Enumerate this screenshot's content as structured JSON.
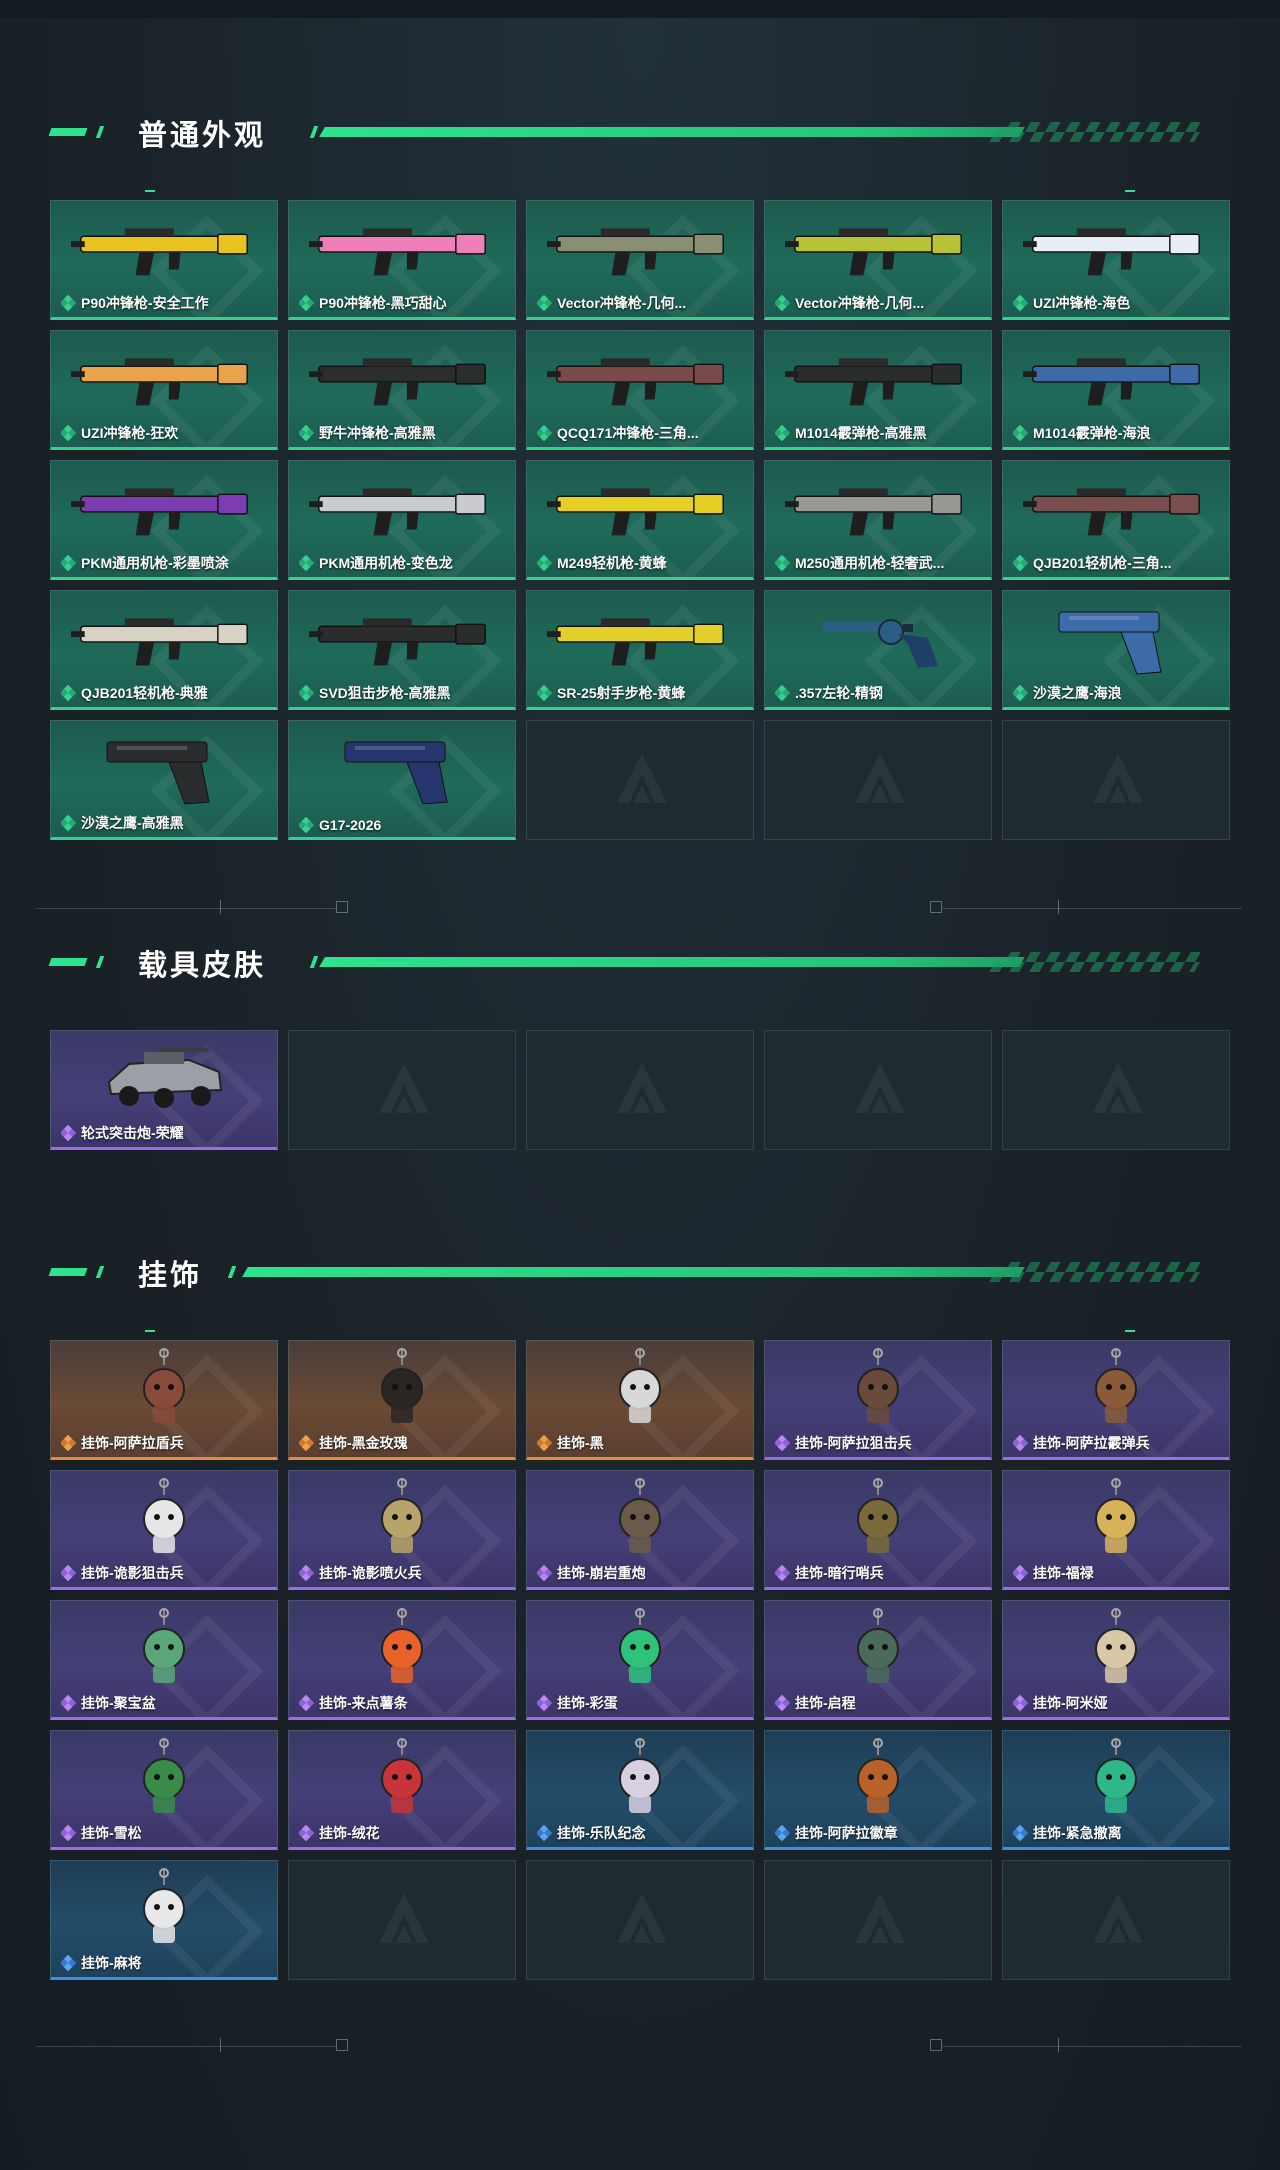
{
  "sections": [
    {
      "title": "普通外观",
      "items": [
        {
          "label": "P90冲锋枪-安全工作",
          "rarity": "green",
          "art": "gun-icon",
          "color": "#e8c321"
        },
        {
          "label": "P90冲锋枪-黑巧甜心",
          "rarity": "green",
          "art": "gun-icon",
          "color": "#ef7fb8"
        },
        {
          "label": "Vector冲锋枪-几何...",
          "rarity": "green",
          "art": "gun-icon",
          "color": "#8a8f74"
        },
        {
          "label": "Vector冲锋枪-几何...",
          "rarity": "green",
          "art": "gun-icon",
          "color": "#b8c238"
        },
        {
          "label": "UZI冲锋枪-海色",
          "rarity": "green",
          "art": "gun-icon",
          "color": "#e9eef6"
        },
        {
          "label": "UZI冲锋枪-狂欢",
          "rarity": "green",
          "art": "gun-icon",
          "color": "#e9a34a"
        },
        {
          "label": "野牛冲锋枪-高雅黑",
          "rarity": "green",
          "art": "gun-icon",
          "color": "#2b2d2f"
        },
        {
          "label": "QCQ171冲锋枪-三角...",
          "rarity": "green",
          "art": "gun-icon",
          "color": "#7a4a4a"
        },
        {
          "label": "M1014霰弹枪-高雅黑",
          "rarity": "green",
          "art": "gun-icon",
          "color": "#2a2c2e"
        },
        {
          "label": "M1014霰弹枪-海浪",
          "rarity": "green",
          "art": "gun-icon",
          "color": "#3d6aa8"
        },
        {
          "label": "PKM通用机枪-彩墨喷涂",
          "rarity": "green",
          "art": "gun-icon",
          "color": "#7b3db0"
        },
        {
          "label": "PKM通用机枪-变色龙",
          "rarity": "green",
          "art": "gun-icon",
          "color": "#c9cbd0"
        },
        {
          "label": "M249轻机枪-黄蜂",
          "rarity": "green",
          "art": "gun-icon",
          "color": "#e6cf23"
        },
        {
          "label": "M250通用机枪-轻奢武...",
          "rarity": "green",
          "art": "gun-icon",
          "color": "#9a9894"
        },
        {
          "label": "QJB201轻机枪-三角...",
          "rarity": "green",
          "art": "gun-icon",
          "color": "#7a4e4e"
        },
        {
          "label": "QJB201轻机枪-典雅",
          "rarity": "green",
          "art": "gun-icon",
          "color": "#d8d2c4"
        },
        {
          "label": "SVD狙击步枪-高雅黑",
          "rarity": "green",
          "art": "gun-icon",
          "color": "#2a2c2e"
        },
        {
          "label": "SR-25射手步枪-黄蜂",
          "rarity": "green",
          "art": "gun-icon",
          "color": "#e3cf2a"
        },
        {
          "label": ".357左轮-精钢",
          "rarity": "green",
          "art": "revolver-icon",
          "color": "#2d5f86"
        },
        {
          "label": "沙漠之鹰-海浪",
          "rarity": "green",
          "art": "pistol-icon",
          "color": "#3d6aa8"
        },
        {
          "label": "沙漠之鹰-高雅黑",
          "rarity": "green",
          "art": "pistol-icon",
          "color": "#2a2c2e"
        },
        {
          "label": "G17-2026",
          "rarity": "green",
          "art": "pistol-icon",
          "color": "#27356e"
        },
        {
          "label": "",
          "rarity": "empty"
        },
        {
          "label": "",
          "rarity": "empty"
        },
        {
          "label": "",
          "rarity": "empty"
        }
      ]
    },
    {
      "title": "载具皮肤",
      "items": [
        {
          "label": "轮式突击炮-荣耀",
          "rarity": "purple",
          "art": "vehicle-icon",
          "color": "#9aa0a6"
        },
        {
          "label": "",
          "rarity": "empty"
        },
        {
          "label": "",
          "rarity": "empty"
        },
        {
          "label": "",
          "rarity": "empty"
        },
        {
          "label": "",
          "rarity": "empty"
        }
      ]
    },
    {
      "title": "挂饰",
      "items": [
        {
          "label": "挂饰-阿萨拉盾兵",
          "rarity": "orange",
          "art": "charm-icon",
          "color": "#8a4a3a"
        },
        {
          "label": "挂饰-黑金玫瑰",
          "rarity": "orange",
          "art": "charm-icon",
          "color": "#2a2624"
        },
        {
          "label": "挂饰-黑",
          "rarity": "orange",
          "art": "charm-icon",
          "color": "#d8d8d8"
        },
        {
          "label": "挂饰-阿萨拉狙击兵",
          "rarity": "purple",
          "art": "charm-icon",
          "color": "#6a4a3a"
        },
        {
          "label": "挂饰-阿萨拉霰弹兵",
          "rarity": "purple",
          "art": "charm-icon",
          "color": "#8a5a3a"
        },
        {
          "label": "挂饰-诡影狙击兵",
          "rarity": "purple",
          "art": "charm-icon",
          "color": "#e6e6e6"
        },
        {
          "label": "挂饰-诡影喷火兵",
          "rarity": "purple",
          "art": "charm-icon",
          "color": "#b7a46a"
        },
        {
          "label": "挂饰-崩岩重炮",
          "rarity": "purple",
          "art": "charm-icon",
          "color": "#6a5a4a"
        },
        {
          "label": "挂饰-暗行哨兵",
          "rarity": "purple",
          "art": "charm-icon",
          "color": "#7a6a3a"
        },
        {
          "label": "挂饰-福禄",
          "rarity": "purple",
          "art": "charm-icon",
          "color": "#d8b25a"
        },
        {
          "label": "挂饰-聚宝盆",
          "rarity": "purple",
          "art": "charm-icon",
          "color": "#5aa87a"
        },
        {
          "label": "挂饰-来点薯条",
          "rarity": "purple",
          "art": "charm-icon",
          "color": "#e8622a"
        },
        {
          "label": "挂饰-彩蛋",
          "rarity": "purple",
          "art": "charm-icon",
          "color": "#2ec27a"
        },
        {
          "label": "挂饰-启程",
          "rarity": "purple",
          "art": "charm-icon",
          "color": "#4a6a5a"
        },
        {
          "label": "挂饰-阿米娅",
          "rarity": "purple",
          "art": "charm-icon",
          "color": "#d8c8a8"
        },
        {
          "label": "挂饰-雪松",
          "rarity": "purple",
          "art": "charm-icon",
          "color": "#3a8a4a"
        },
        {
          "label": "挂饰-绒花",
          "rarity": "purple",
          "art": "charm-icon",
          "color": "#c8343a"
        },
        {
          "label": "挂饰-乐队纪念",
          "rarity": "blue",
          "art": "charm-icon",
          "color": "#d8d0e0"
        },
        {
          "label": "挂饰-阿萨拉徽章",
          "rarity": "blue",
          "art": "charm-icon",
          "color": "#b8622a"
        },
        {
          "label": "挂饰-紧急撤离",
          "rarity": "blue",
          "art": "charm-icon",
          "color": "#2eb88a"
        },
        {
          "label": "挂饰-麻将",
          "rarity": "blue",
          "art": "charm-icon",
          "color": "#e8e8e8"
        },
        {
          "label": "",
          "rarity": "empty"
        },
        {
          "label": "",
          "rarity": "empty"
        },
        {
          "label": "",
          "rarity": "empty"
        },
        {
          "label": "",
          "rarity": "empty"
        }
      ]
    }
  ],
  "colors": {
    "accent": "#2ee28e",
    "green_rarity": "#34d191",
    "purple_rarity": "#9b6ce6",
    "orange_rarity": "#e88a3a",
    "blue_rarity": "#3e8ee3"
  }
}
